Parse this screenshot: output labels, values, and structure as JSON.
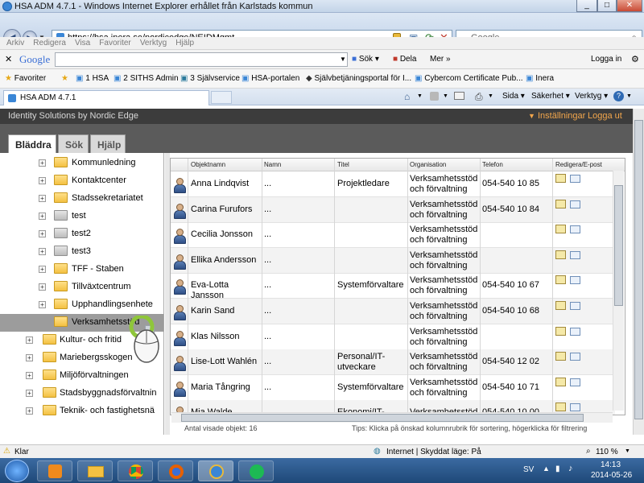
{
  "window": {
    "title": "HSA ADM 4.7.1 - Windows Internet Explorer erhållet från Karlstads kommun",
    "buttons": {
      "min": "_",
      "max": "□",
      "close": "✕"
    }
  },
  "address": {
    "url": "https://hsa.inera.se/nordicedge/NEIDMgmt",
    "search_placeholder": "Google"
  },
  "menubar": [
    "Arkiv",
    "Redigera",
    "Visa",
    "Favoriter",
    "Verktyg",
    "Hjälp"
  ],
  "google_bar": {
    "logo": "Google",
    "search_label": "Sök",
    "share_label": "Dela",
    "more_label": "Mer »",
    "login_label": "Logga in"
  },
  "favorites": {
    "label": "Favoriter",
    "items": [
      "1 HSA",
      "2 SITHS Admin",
      "3 Självservice",
      "HSA-portalen",
      "Självbetjäningsportal för I...",
      "Cybercom Certificate Pub...",
      "Inera"
    ]
  },
  "tab": {
    "label": "HSA ADM 4.7.1"
  },
  "commandbar": {
    "page": "Sida",
    "safety": "Säkerhet",
    "tools": "Verktyg"
  },
  "site": {
    "brand": "Identity Solutions by Nordic Edge",
    "settings": "Inställningar",
    "logout": "Logga ut",
    "nav_tabs": [
      "Bläddra",
      "Sök",
      "Hjälp"
    ]
  },
  "tree": [
    {
      "label": "Kommunledning",
      "type": "folder",
      "expander": "+"
    },
    {
      "label": "Kontaktcenter",
      "type": "folder",
      "expander": "+"
    },
    {
      "label": "Stadssekretariatet",
      "type": "folder",
      "expander": "+"
    },
    {
      "label": "test",
      "type": "grey",
      "expander": "+"
    },
    {
      "label": "test2",
      "type": "grey",
      "expander": "+"
    },
    {
      "label": "test3",
      "type": "grey",
      "expander": "+"
    },
    {
      "label": "TFF - Staben",
      "type": "folder",
      "expander": "+"
    },
    {
      "label": "Tillväxtcentrum",
      "type": "folder",
      "expander": "+"
    },
    {
      "label": "Upphandlingsenhete",
      "type": "folder",
      "expander": "+"
    },
    {
      "label": "Verksamhetsstöd",
      "type": "open",
      "expander": ""
    },
    {
      "label": "Kultur- och fritid",
      "type": "folder",
      "expander": "+"
    },
    {
      "label": "Mariebergsskogen",
      "type": "folder",
      "expander": "+"
    },
    {
      "label": "Miljöförvaltningen",
      "type": "folder",
      "expander": "+"
    },
    {
      "label": "Stadsbyggnadsförvaltnin",
      "type": "folder",
      "expander": "+"
    },
    {
      "label": "Teknik- och fastighetsnä",
      "type": "folder",
      "expander": "+"
    }
  ],
  "grid": {
    "columns": [
      "Objektnamn",
      "Namn",
      "Titel",
      "Organisation",
      "Telefon",
      "Redigera/E-post"
    ],
    "rows": [
      {
        "objektnamn": "Anna Lindqvist",
        "namn": "...",
        "titel": "Projektledare",
        "organisation": "Verksamhetsstöd och förvaltning",
        "telefon": "054-540 10 85"
      },
      {
        "objektnamn": "Carina Furufors",
        "namn": "...",
        "titel": "",
        "organisation": "Verksamhetsstöd och förvaltning",
        "telefon": "054-540 10 84"
      },
      {
        "objektnamn": "Cecilia Jonsson",
        "namn": "...",
        "titel": "",
        "organisation": "Verksamhetsstöd och förvaltning",
        "telefon": ""
      },
      {
        "objektnamn": "Ellika Andersson",
        "namn": "...",
        "titel": "",
        "organisation": "Verksamhetsstöd och förvaltning",
        "telefon": ""
      },
      {
        "objektnamn": "Eva-Lotta Jansson",
        "namn": "...",
        "titel": "Systemförvaltare",
        "organisation": "Verksamhetsstöd och förvaltning",
        "telefon": "054-540 10 67"
      },
      {
        "objektnamn": "Karin Sand",
        "namn": "...",
        "titel": "",
        "organisation": "Verksamhetsstöd och förvaltning",
        "telefon": "054-540 10 68"
      },
      {
        "objektnamn": "Klas Nilsson",
        "namn": "...",
        "titel": "",
        "organisation": "Verksamhetsstöd och förvaltning",
        "telefon": ""
      },
      {
        "objektnamn": "Lise-Lott Wahlén",
        "namn": "...",
        "titel": "Personal/IT-utveckare",
        "organisation": "Verksamhetsstöd och förvaltning",
        "telefon": "054-540 12 02"
      },
      {
        "objektnamn": "Maria Tångring",
        "namn": "...",
        "titel": "Systemförvaltare",
        "organisation": "Verksamhetsstöd och förvaltning",
        "telefon": "054-540 10 71"
      },
      {
        "objektnamn": "Mia Walde...",
        "namn": "...",
        "titel": "Ekonomi/IT-",
        "organisation": "Verksamhetsstöd",
        "telefon": "054-540 10 00"
      }
    ],
    "footer_count": "Antal visade objekt: 16",
    "footer_tip": "Tips: Klicka på önskad kolumnrubrik för sortering, högerklicka för filtrering"
  },
  "status": {
    "ready": "Klar",
    "zone": "Internet | Skyddat läge: På",
    "zoom": "110 %"
  },
  "taskbar": {
    "lang": "SV",
    "time": "14:13",
    "date": "2014-05-26"
  }
}
